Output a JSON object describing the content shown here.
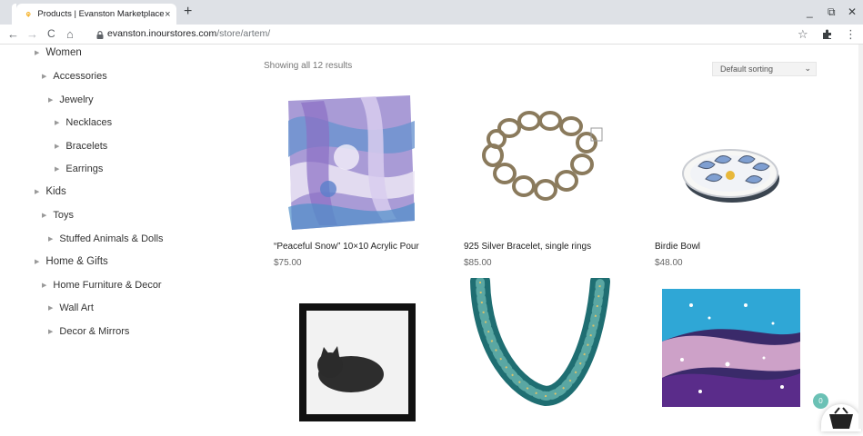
{
  "browser": {
    "tab_title": "Products | Evanston Marketplace",
    "tab_close": "×",
    "new_tab": "+",
    "url_host": "evanston.inourstores.com",
    "url_path": "/store/artem/",
    "win_minimize": "_",
    "win_restore": "⧉",
    "win_close": "✕",
    "back": "←",
    "forward": "→",
    "reload": "C",
    "home": "⌂",
    "star": "☆",
    "menu": "⋮"
  },
  "sidebar": {
    "items": [
      {
        "label": "Women",
        "level": 0
      },
      {
        "label": "Accessories",
        "level": 1
      },
      {
        "label": "Jewelry",
        "level": 2
      },
      {
        "label": "Necklaces",
        "level": 3
      },
      {
        "label": "Bracelets",
        "level": 3
      },
      {
        "label": "Earrings",
        "level": 3
      },
      {
        "label": "Kids",
        "level": 0
      },
      {
        "label": "Toys",
        "level": 1
      },
      {
        "label": "Stuffed Animals & Dolls",
        "level": 2
      },
      {
        "label": "Home & Gifts",
        "level": 0
      },
      {
        "label": "Home Furniture & Decor",
        "level": 1
      },
      {
        "label": "Wall Art",
        "level": 2
      },
      {
        "label": "Decor & Mirrors",
        "level": 2
      }
    ]
  },
  "main": {
    "results_text": "Showing all 12 results",
    "sort_label": "Default sorting",
    "sort_arrow": "⌄",
    "products": [
      {
        "name": "“Peaceful Snow” 10×10 Acrylic Pour",
        "price": "$75.00"
      },
      {
        "name": "925 Silver Bracelet, single rings",
        "price": "$85.00"
      },
      {
        "name": "Birdie Bowl",
        "price": "$48.00"
      }
    ]
  },
  "cart": {
    "count": "0"
  },
  "colors": {
    "accent": "#6bc1b5",
    "tabstrip": "#dee1e6"
  }
}
